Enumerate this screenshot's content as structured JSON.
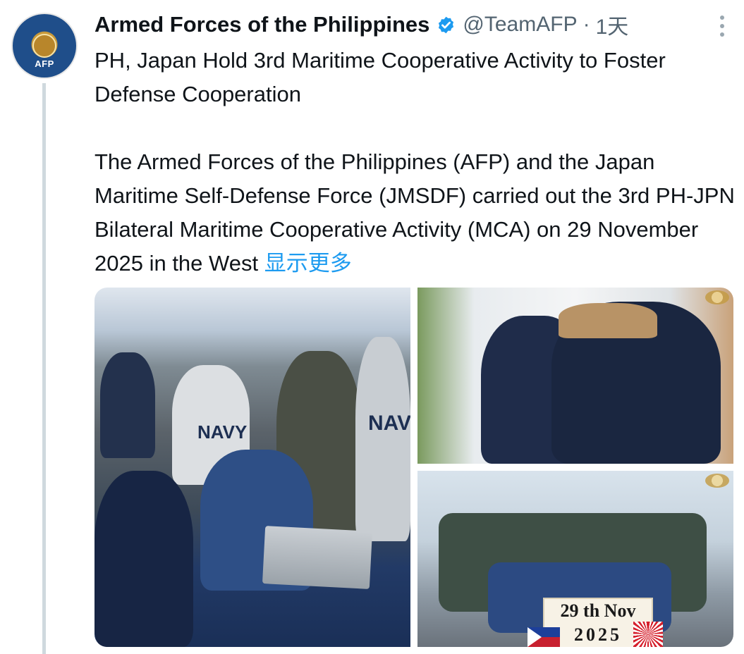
{
  "tweet": {
    "author_name": "Armed Forces of the Philippines",
    "handle": "@TeamAFP",
    "separator": "·",
    "time": "1天",
    "avatar_text": "AFP",
    "text_line1": "PH, Japan Hold 3rd Maritime Cooperative Activity to Foster Defense Cooperation",
    "text_line2": "The Armed Forces of the Philippines (AFP) and the Japan Maritime Self-Defense Force (JMSDF) carried out the 3rd PH-JPN Bilateral Maritime Cooperative Activity (MCA) on 29 November 2025 in the West",
    "show_more": "显示更多"
  },
  "media": {
    "photo1_navy_a": "NAVY",
    "photo1_navy_b": "NAVY",
    "photo3_sign_line1": "29 th Nov",
    "photo3_sign_line2": "2025"
  },
  "icons": {
    "verified": "verified-badge-icon",
    "more": "more-vertical-icon"
  },
  "colors": {
    "link": "#1d9bf0",
    "secondary_text": "#536471",
    "verified": "#1d9bf0"
  }
}
